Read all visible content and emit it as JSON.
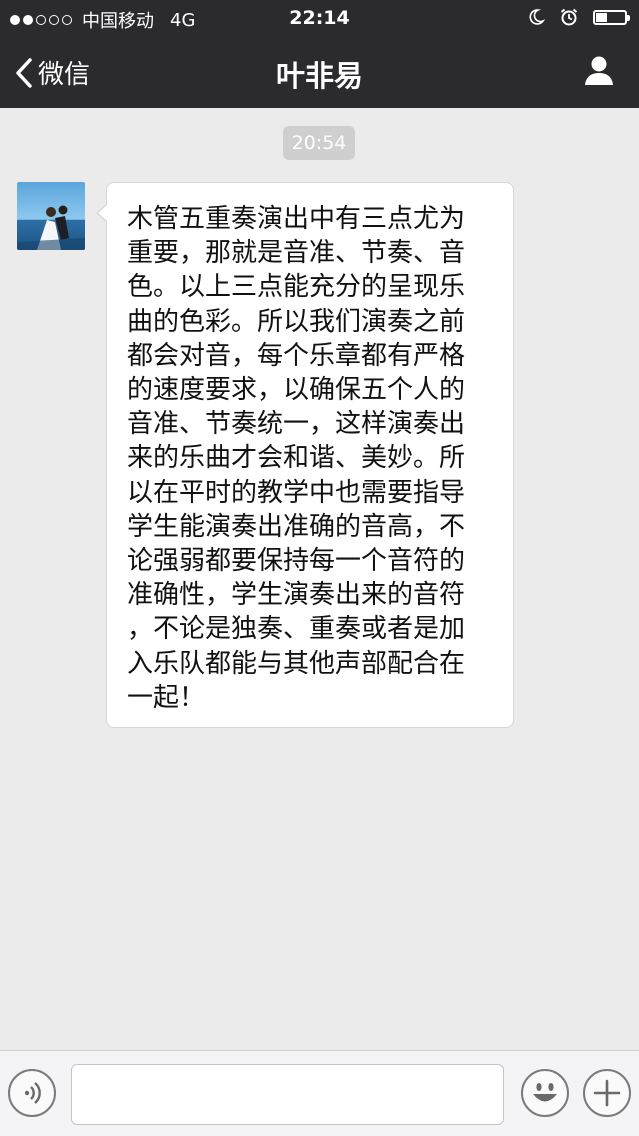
{
  "status_bar": {
    "carrier": "中国移动",
    "network": "4G",
    "time": "22:14"
  },
  "nav": {
    "back_label": "微信",
    "title": "叶非易"
  },
  "chat": {
    "timestamp": "20:54",
    "message_lines": [
      "木管五重奏演出中有三点尤为",
      "重要，那就是音准、节奏、音",
      "色。以上三点能充分的呈现乐",
      "曲的色彩。所以我们演奏之前",
      "都会对音，每个乐章都有严格",
      "的速度要求，以确保五个人的",
      "音准、节奏统一，这样演奏出",
      "来的乐曲才会和谐、美妙。所",
      "以在平时的教学中也需要指导",
      "学生能演奏出准确的音高，不",
      "论强弱都要保持每一个音符的",
      "准确性，学生演奏出来的音符",
      "，不论是独奏、重奏或者是加",
      "入乐队都能与其他声部配合在",
      "一起！"
    ]
  },
  "input_bar": {
    "value": "",
    "placeholder": ""
  },
  "icons": {
    "voice": "voice-icon",
    "emoji": "emoji-icon",
    "add": "plus-icon"
  },
  "colors": {
    "bar_bg": "#2b2b2d",
    "chat_bg": "#ebebeb",
    "bubble_bg": "#ffffff",
    "timestamp_bg": "#cfcfcf"
  }
}
